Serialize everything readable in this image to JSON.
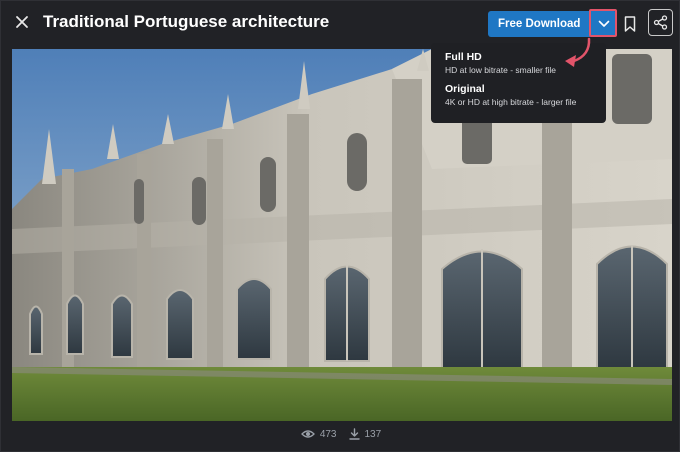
{
  "header": {
    "title": "Traditional Portuguese architecture",
    "download_label": "Free Download"
  },
  "download_menu": {
    "items": [
      {
        "title": "Full HD",
        "description": "HD at low bitrate - smaller file"
      },
      {
        "title": "Original",
        "description": "4K or HD at high bitrate - larger file"
      }
    ]
  },
  "stats": {
    "views": "473",
    "downloads": "137"
  },
  "colors": {
    "background": "#212226",
    "accent": "#1f77c4",
    "highlight": "#e2546a"
  },
  "icons": [
    "close-icon",
    "chevron-down-icon",
    "bookmark-icon",
    "share-icon",
    "eye-icon",
    "download-icon"
  ]
}
